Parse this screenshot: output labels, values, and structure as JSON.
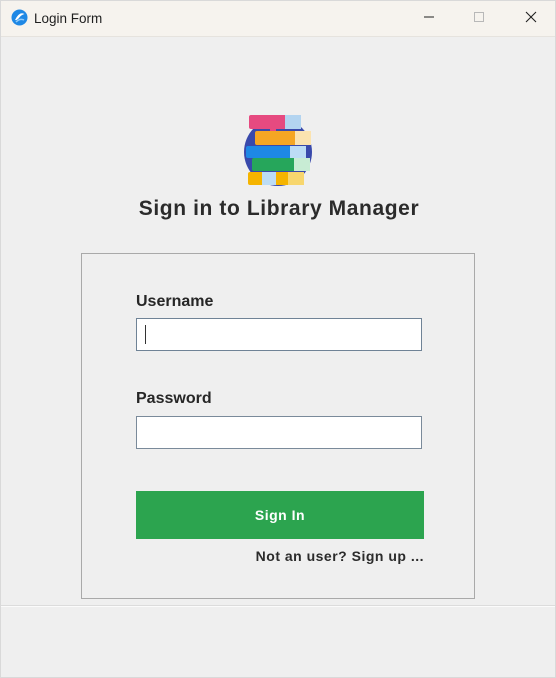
{
  "window": {
    "title": "Login Form",
    "controls": {
      "minimize_icon": "minimize-icon",
      "maximize_icon": "maximize-icon",
      "close_icon": "close-icon"
    },
    "app_icon": "app-icon"
  },
  "header": {
    "logo_icon": "books-stack-logo",
    "title": "Sign in to Library Manager"
  },
  "form": {
    "username_label": "Username",
    "username_value": "",
    "username_placeholder": "",
    "password_label": "Password",
    "password_value": "",
    "password_placeholder": "",
    "signin_label": "Sign In",
    "signup_link": "Not an user? Sign up ..."
  },
  "colors": {
    "primary_button": "#2ca44f",
    "window_background": "#efefef",
    "titlebar_background": "#f6f3ee",
    "text": "#2b2b2b"
  }
}
